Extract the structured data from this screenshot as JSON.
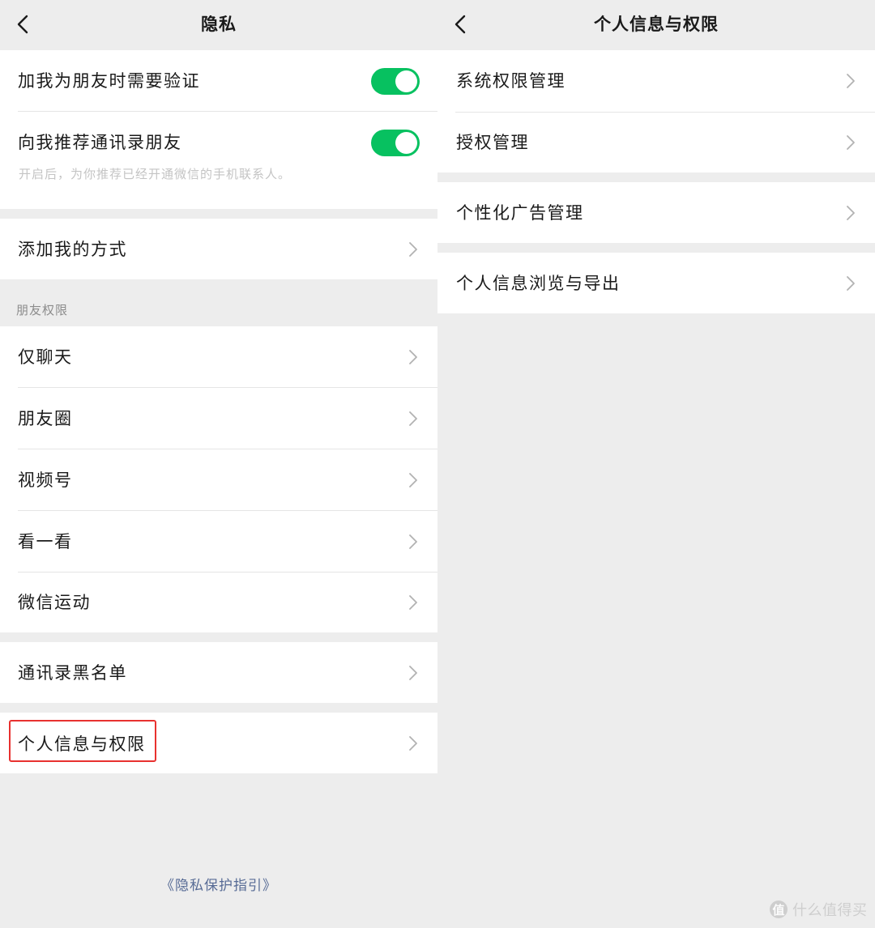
{
  "left_screen": {
    "title": "隐私",
    "verify_label": "加我为朋友时需要验证",
    "verify_toggle": true,
    "recommend_label": "向我推荐通讯录朋友",
    "recommend_toggle": true,
    "recommend_hint": "开启后，为你推荐已经开通微信的手机联系人。",
    "add_methods_label": "添加我的方式",
    "friend_permissions_header": "朋友权限",
    "friend_items": [
      "仅聊天",
      "朋友圈",
      "视频号",
      "看一看",
      "微信运动"
    ],
    "blacklist_label": "通讯录黑名单",
    "personal_info_label": "个人信息与权限",
    "footer_link": "《隐私保护指引》"
  },
  "right_screen": {
    "title": "个人信息与权限",
    "items": [
      "系统权限管理",
      "授权管理",
      "个性化广告管理",
      "个人信息浏览与导出"
    ]
  },
  "watermark": {
    "logo_char": "值",
    "text": "什么值得买"
  },
  "colors": {
    "background": "#ededed",
    "toggle_on": "#07c160",
    "link": "#576b95",
    "highlight_border": "#e8312f",
    "hint_text": "#c4c4c4",
    "section_header": "#8c8c8c"
  },
  "icons": {
    "back": "chevron-left-icon",
    "row_arrow": "chevron-right-icon"
  }
}
